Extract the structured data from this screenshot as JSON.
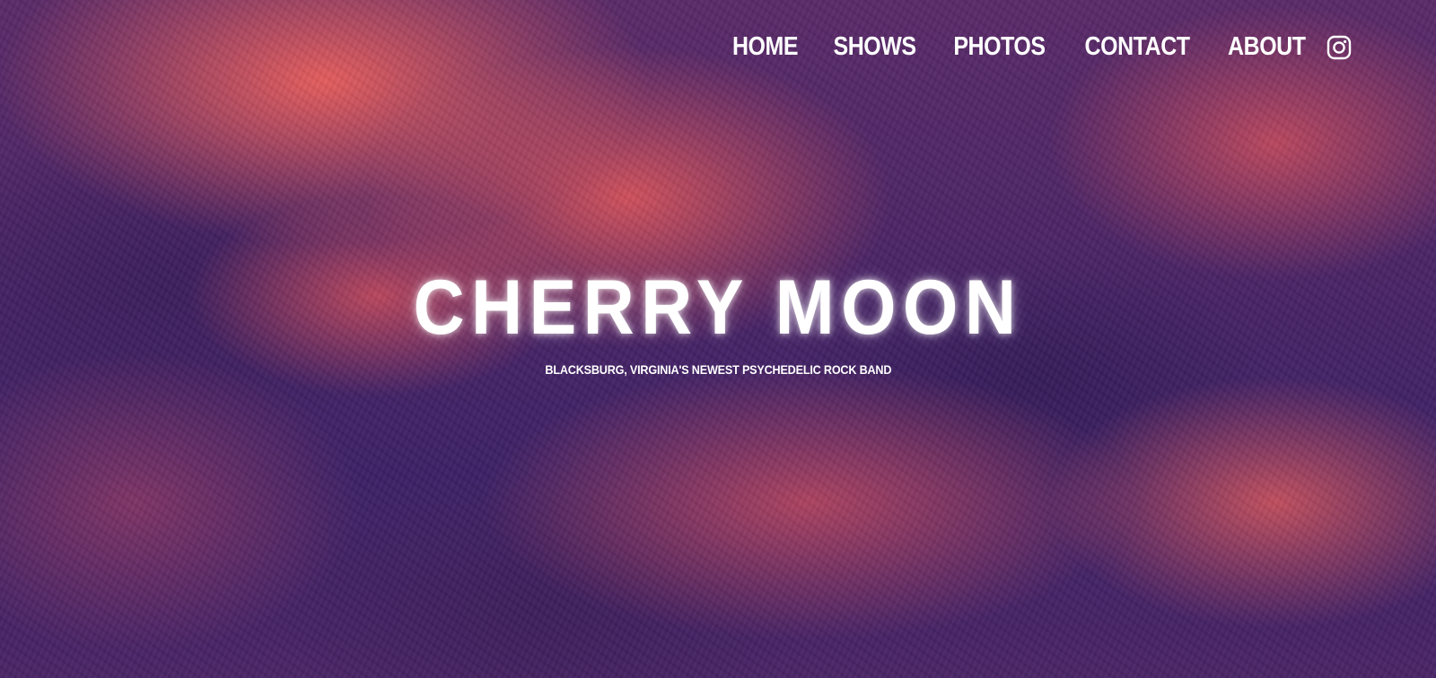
{
  "site": {
    "band_name": "CHERRY MOON",
    "tagline": "BLACKSBURG, VIRGINIA'S NEWEST PSYCHEDELIC ROCK BAND"
  },
  "nav": {
    "items": [
      {
        "label": "HOME"
      },
      {
        "label": "SHOWS"
      },
      {
        "label": "PHOTOS"
      },
      {
        "label": "CONTACT"
      },
      {
        "label": "ABOUT"
      }
    ],
    "social_icon": "instagram-icon"
  },
  "colors": {
    "background_dark": "#3c2166",
    "background_accent": "#ec605c",
    "text": "#ffffff"
  }
}
